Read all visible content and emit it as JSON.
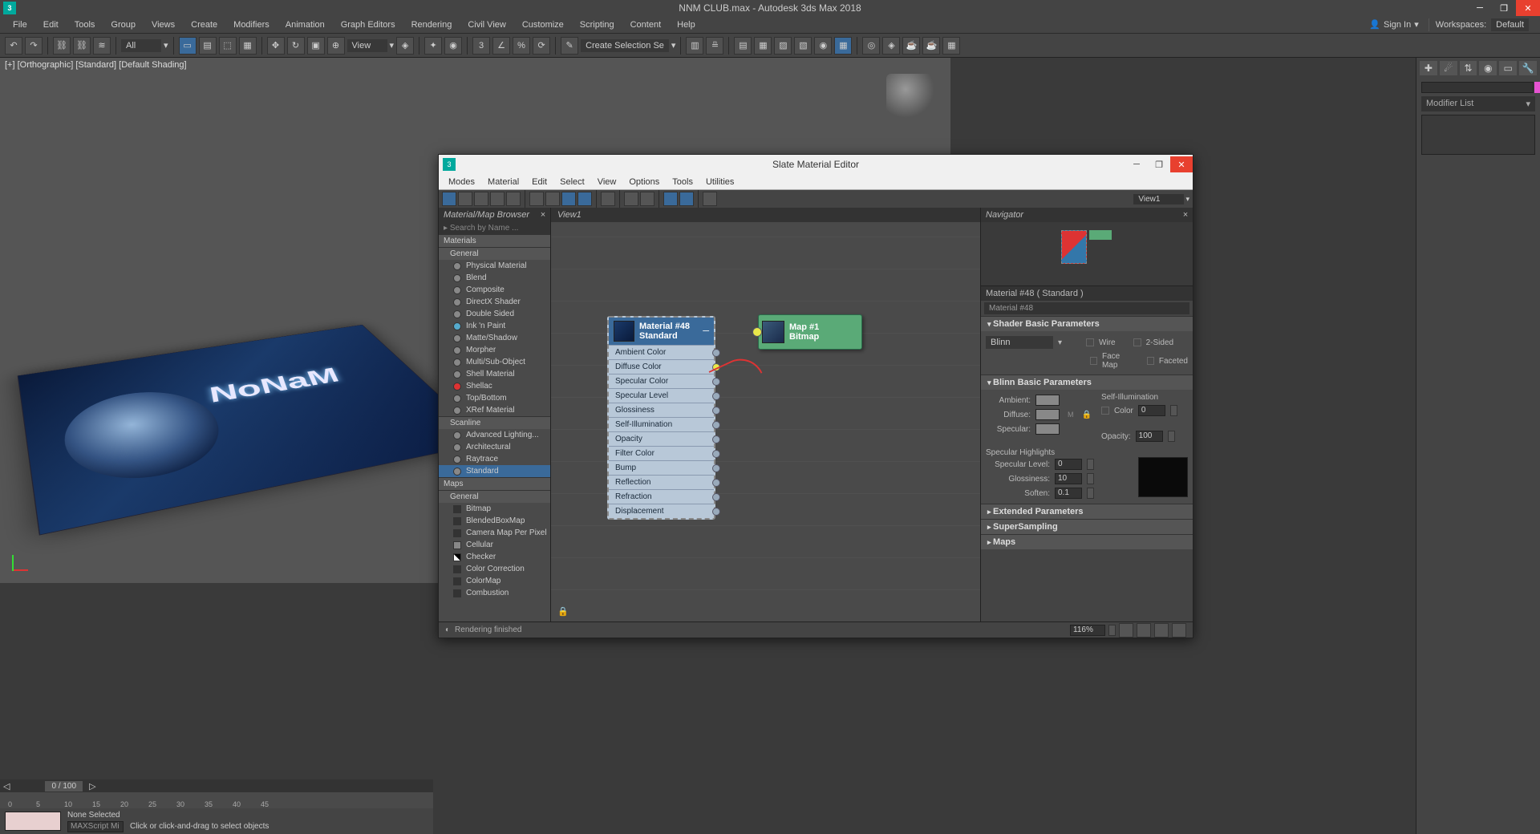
{
  "title": "NNM CLUB.max - Autodesk 3ds Max 2018",
  "menu": [
    "File",
    "Edit",
    "Tools",
    "Group",
    "Views",
    "Create",
    "Modifiers",
    "Animation",
    "Graph Editors",
    "Rendering",
    "Civil View",
    "Customize",
    "Scripting",
    "Content",
    "Help"
  ],
  "signin": "Sign In",
  "workspaces_label": "Workspaces:",
  "workspace": "Default",
  "toolbar_all": "All",
  "toolbar_view": "View",
  "toolbar_selset": "Create Selection Se",
  "viewport_label": "[+] [Orthographic] [Standard] [Default Shading]",
  "viewport_text": "NoNaM",
  "modifier_list": "Modifier List",
  "time_label": "0 / 100",
  "time_marks": [
    "0",
    "5",
    "10",
    "15",
    "20",
    "25",
    "30",
    "35",
    "40",
    "45"
  ],
  "status_sel": "None Selected",
  "status_hint": "Click or click-and-drag to select objects",
  "status_script": "MAXScript Mi",
  "slate": {
    "title": "Slate Material Editor",
    "menu": [
      "Modes",
      "Material",
      "Edit",
      "Select",
      "View",
      "Options",
      "Tools",
      "Utilities"
    ],
    "browser_title": "Material/Map Browser",
    "search": "Search by Name ...",
    "view_name": "View1",
    "view_sel": "View1",
    "nav_title": "Navigator",
    "cats": {
      "materials": "Materials",
      "general": "General",
      "scanline": "Scanline",
      "maps": "Maps",
      "general2": "General"
    },
    "mat_general": [
      "Physical Material",
      "Blend",
      "Composite",
      "DirectX Shader",
      "Double Sided",
      "Ink 'n Paint",
      "Matte/Shadow",
      "Morpher",
      "Multi/Sub-Object",
      "Shell Material",
      "Shellac",
      "Top/Bottom",
      "XRef Material"
    ],
    "mat_scanline": [
      "Advanced Lighting...",
      "Architectural",
      "Raytrace",
      "Standard"
    ],
    "map_general": [
      "Bitmap",
      "BlendedBoxMap",
      "Camera Map Per Pixel",
      "Cellular",
      "Checker",
      "Color Correction",
      "ColorMap",
      "Combustion"
    ],
    "matnode_name": "Material #48",
    "matnode_type": "Standard",
    "slots": [
      "Ambient Color",
      "Diffuse Color",
      "Specular Color",
      "Specular Level",
      "Glossiness",
      "Self-Illumination",
      "Opacity",
      "Filter Color",
      "Bump",
      "Reflection",
      "Refraction",
      "Displacement"
    ],
    "mapnode_name": "Map #1",
    "mapnode_type": "Bitmap",
    "param_title": "Material #48  ( Standard )",
    "param_name": "Material #48",
    "rollouts": {
      "shader": "Shader Basic Parameters",
      "blinn": "Blinn Basic Parameters",
      "ext": "Extended Parameters",
      "ss": "SuperSampling",
      "maps": "Maps"
    },
    "shader_type": "Blinn",
    "wire": "Wire",
    "twosided": "2-Sided",
    "facemap": "Face Map",
    "faceted": "Faceted",
    "ambient": "Ambient:",
    "diffuse": "Diffuse:",
    "specular": "Specular:",
    "selfillum": "Self-Illumination",
    "color_lbl": "Color",
    "color_val": "0",
    "opacity": "Opacity:",
    "opacity_val": "100",
    "highlights": "Specular Highlights",
    "speclevel": "Specular Level:",
    "speclevel_val": "0",
    "gloss": "Glossiness:",
    "gloss_val": "10",
    "soften": "Soften:",
    "soften_val": "0.1",
    "status": "Rendering finished",
    "zoom": "116%"
  }
}
